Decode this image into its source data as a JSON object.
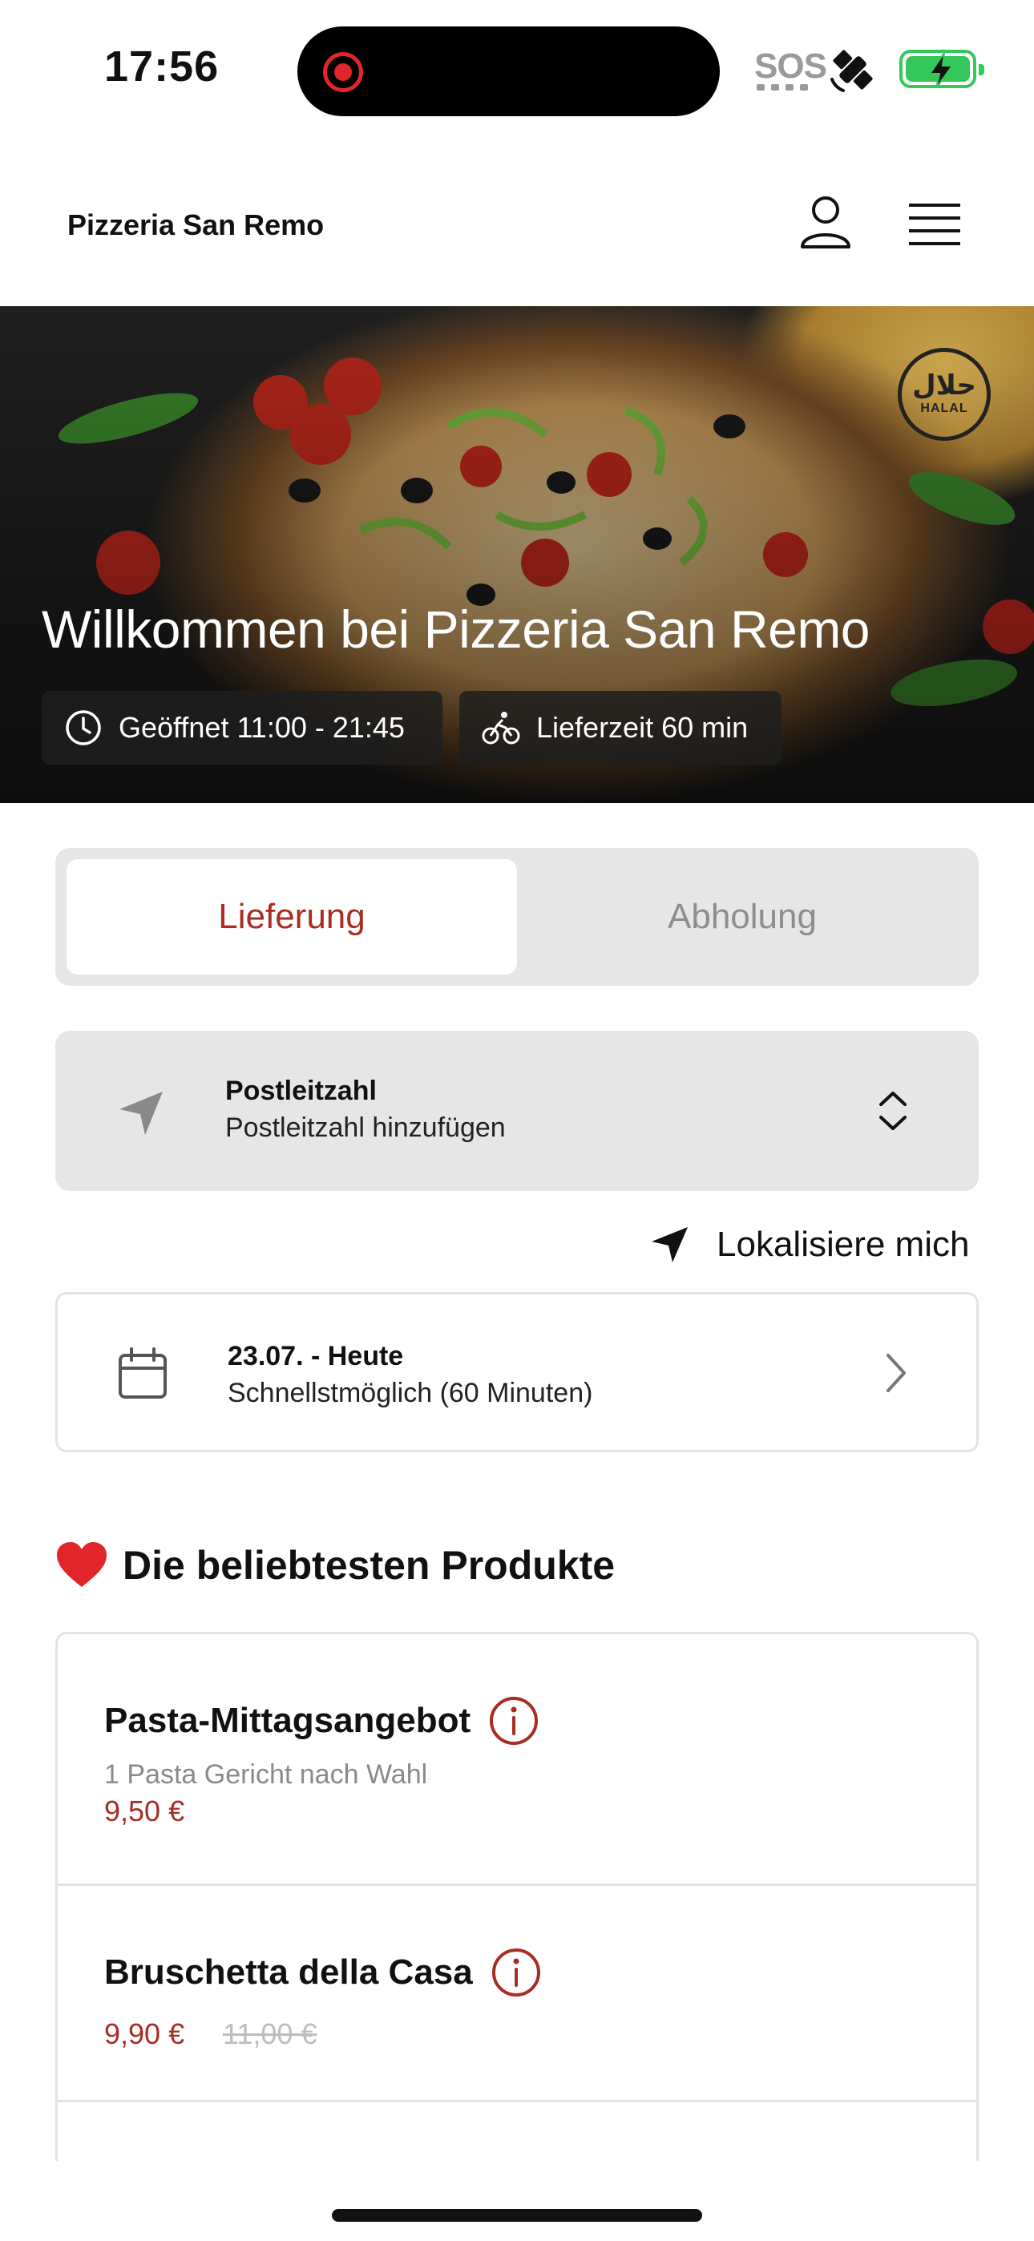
{
  "status_bar": {
    "time": "17:56",
    "sos": "SOS",
    "icons": [
      "screen-recording-icon",
      "satellite-icon",
      "battery-charging-icon"
    ],
    "battery_color": "#34c759",
    "recording_color": "#e0262b"
  },
  "header": {
    "brand": "Pizzeria San Remo",
    "icons": [
      "user-icon",
      "menu-icon"
    ]
  },
  "hero": {
    "title": "Willkommen bei Pizzeria San Remo",
    "halal_badge": {
      "arabic": "حلال",
      "text": "HALAL"
    },
    "opening_hours": "Geöffnet 11:00 - 21:45",
    "delivery_time": "Lieferzeit 60 min"
  },
  "mode_toggle": {
    "options": [
      "Lieferung",
      "Abholung"
    ],
    "selected": "Lieferung",
    "accent": "#a82d22"
  },
  "postcode": {
    "title": "Postleitzahl",
    "placeholder": "Postleitzahl hinzufügen"
  },
  "locate_label": "Lokalisiere mich",
  "date": {
    "title": "23.07. - Heute",
    "subtitle": "Schnellstmöglich (60 Minuten)"
  },
  "popular": {
    "title": "Die beliebtesten Produkte",
    "products": [
      {
        "name": "Pasta-Mittagsangebot",
        "description": "1 Pasta Gericht nach Wahl",
        "price": "9,50 €"
      },
      {
        "name": "Bruschetta della Casa",
        "price": "9,90 €",
        "old_price": "11,00 €"
      }
    ]
  }
}
